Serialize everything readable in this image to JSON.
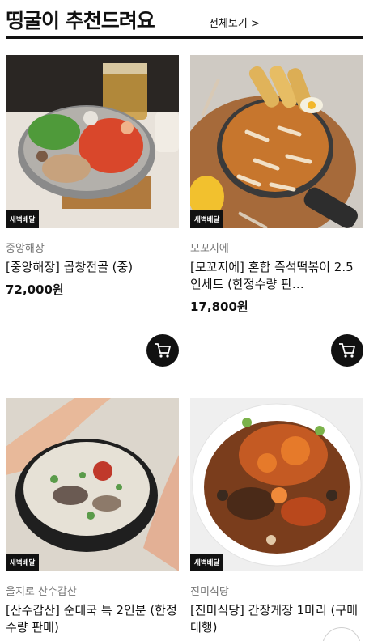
{
  "header": {
    "title": "띵굴이 추천드려요",
    "more_label": "전체보기 >"
  },
  "colors": {
    "text": "#111111",
    "store_text": "#777777",
    "badge_bg": "#111111"
  },
  "products": [
    {
      "badge": "새벽배달",
      "store": "중앙해장",
      "name": "[중앙해장] 곱창전골 (중)",
      "price": "72,000원",
      "image": "hotpot-food-icon"
    },
    {
      "badge": "새벽배달",
      "store": "모꼬지에",
      "name": "[모꼬지에] 혼합 즉석떡볶이 2.5인세트 (한정수량 판…",
      "price": "17,800원",
      "image": "tteokbokki-food-icon"
    },
    {
      "badge": "새벽배달",
      "store": "을지로 산수갑산",
      "name": "[산수갑산] 순대국 특 2인분 (한정수량 판매)",
      "price": "",
      "image": "soup-bowl-food-icon"
    },
    {
      "badge": "새벽배달",
      "store": "진미식당",
      "name": "[진미식당] 간장게장 1마리 (구매대행)",
      "price": "",
      "image": "crab-food-icon"
    }
  ]
}
